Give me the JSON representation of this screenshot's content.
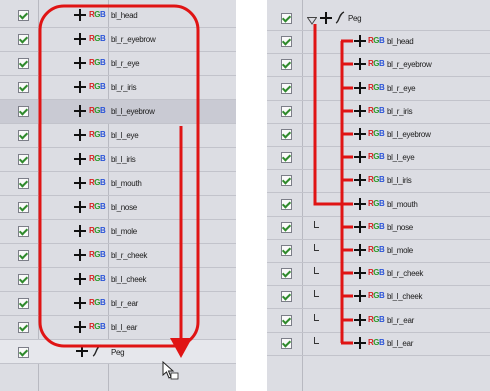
{
  "left_panel": {
    "rows": [
      {
        "label": "bl_head"
      },
      {
        "label": "bl_r_eyebrow"
      },
      {
        "label": "bl_r_eye"
      },
      {
        "label": "bl_r_iris"
      },
      {
        "label": "bl_l_eyebrow"
      },
      {
        "label": "bl_l_eye"
      },
      {
        "label": "bl_l_iris"
      },
      {
        "label": "bl_mouth"
      },
      {
        "label": "bl_nose"
      },
      {
        "label": "bl_mole"
      },
      {
        "label": "bl_r_cheek"
      },
      {
        "label": "bl_l_cheek"
      },
      {
        "label": "bl_r_ear"
      },
      {
        "label": "bl_l_ear"
      }
    ],
    "peg_row": {
      "label": "Peg"
    }
  },
  "right_panel": {
    "peg_row": {
      "label": "Peg"
    },
    "rows": [
      {
        "label": "bl_head"
      },
      {
        "label": "bl_r_eyebrow"
      },
      {
        "label": "bl_r_eye"
      },
      {
        "label": "bl_r_iris"
      },
      {
        "label": "bl_l_eyebrow"
      },
      {
        "label": "bl_l_eye"
      },
      {
        "label": "bl_l_iris"
      },
      {
        "label": "bl_mouth"
      },
      {
        "label": "bl_nose"
      },
      {
        "label": "bl_mole"
      },
      {
        "label": "bl_r_cheek"
      },
      {
        "label": "bl_l_cheek"
      },
      {
        "label": "bl_r_ear"
      },
      {
        "label": "bl_l_ear"
      }
    ]
  },
  "icons": {
    "checkbox": "checkbox-checked-icon",
    "add": "plus-icon",
    "drawing": "rgb-drawing-icon",
    "peg": "peg-icon",
    "cursor": "drag-cursor-icon"
  },
  "colors": {
    "annotation": "#e01414",
    "panel_bg": "#dcdde3",
    "row_border": "#c2c3cb",
    "check": "#2f8a2c"
  }
}
